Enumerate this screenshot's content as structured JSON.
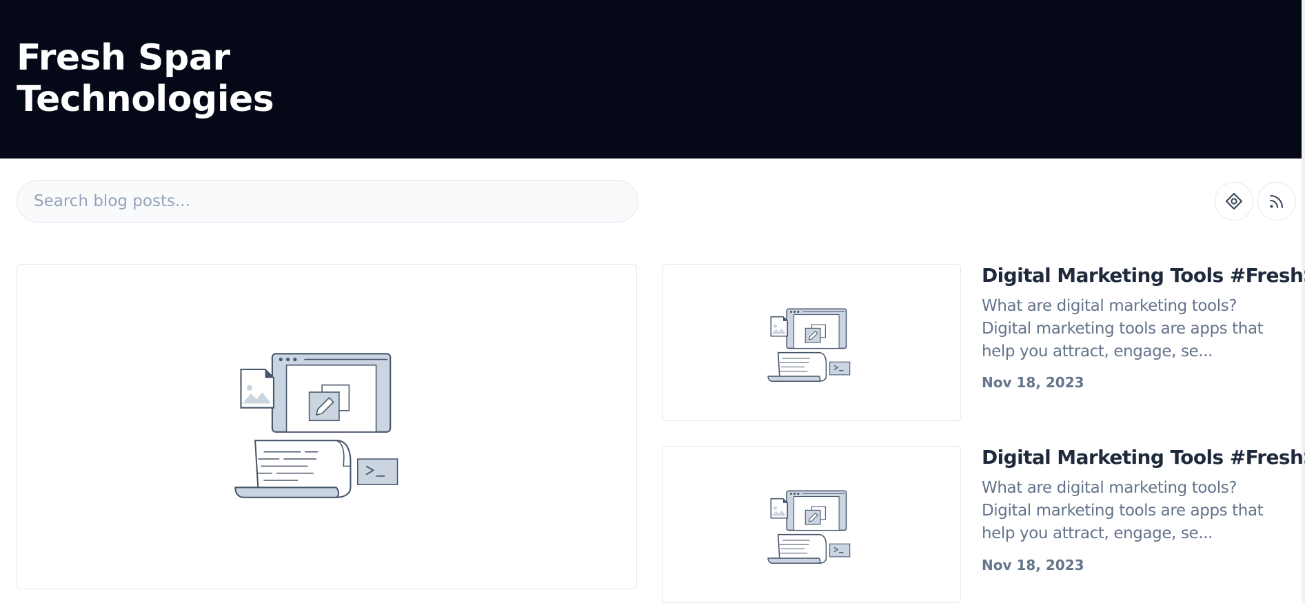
{
  "header": {
    "brand": "Fresh Spar Technologies"
  },
  "search": {
    "placeholder": "Search blog posts...",
    "value": ""
  },
  "actions": {
    "left_icon": "diamond-target-icon",
    "right_icon": "rss-icon"
  },
  "featured": {
    "image_icon": "blog-illustration-icon"
  },
  "posts": [
    {
      "title": "Digital Marketing Tools #FreshSpar",
      "excerpt": "What are digital marketing tools? Digital marketing tools are apps that help you attract, engage, se...",
      "date": "Nov 18, 2023",
      "image_icon": "blog-illustration-icon"
    },
    {
      "title": "Digital Marketing Tools #FreshSpar",
      "excerpt": "What are digital marketing tools? Digital marketing tools are apps that help you attract, engage, se...",
      "date": "Nov 18, 2023",
      "image_icon": "blog-illustration-icon"
    }
  ],
  "colors": {
    "header_bg": "#050816",
    "illustration_fill": "#cbd5e1",
    "illustration_stroke": "#475569"
  }
}
